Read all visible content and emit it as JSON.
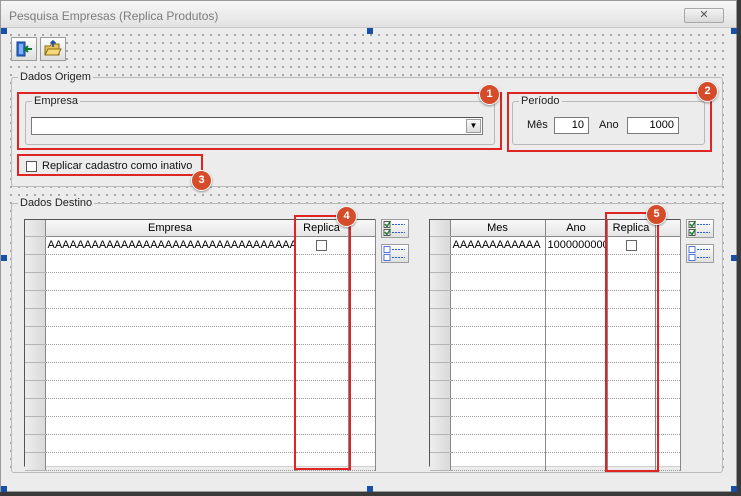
{
  "window": {
    "title": "Pesquisa Empresas (Replica Produtos)",
    "close_glyph": "✕"
  },
  "toolbar": [
    {
      "name": "exit-door-icon"
    },
    {
      "name": "open-folder-icon"
    }
  ],
  "origem": {
    "group_label": "Dados Origem",
    "empresa_label": "Empresa",
    "empresa_value": "",
    "combo_arrow": "▼",
    "periodo_label": "Período",
    "mes_label": "Mês",
    "mes_value": "10",
    "ano_label": "Ano",
    "ano_value": "1000",
    "inativo_label": "Replicar cadastro como inativo"
  },
  "destino": {
    "group_label": "Dados Destino",
    "left_grid": {
      "headers": [
        "Empresa",
        "Replica"
      ],
      "rows": [
        {
          "empresa": "AAAAAAAAAAAAAAAAAAAAAAAAAAAAAAAAAAAAAA"
        }
      ]
    },
    "right_grid": {
      "headers": [
        "Mes",
        "Ano",
        "Replica"
      ],
      "rows": [
        {
          "mes": "AAAAAAAAAAAA",
          "ano": "1000000000"
        }
      ]
    }
  },
  "annotations": [
    "1",
    "2",
    "3",
    "4",
    "5"
  ],
  "colors": {
    "annotation_border": "#e02424",
    "badge": "#d54c2b",
    "selection_handle": "#1a4fa8"
  }
}
